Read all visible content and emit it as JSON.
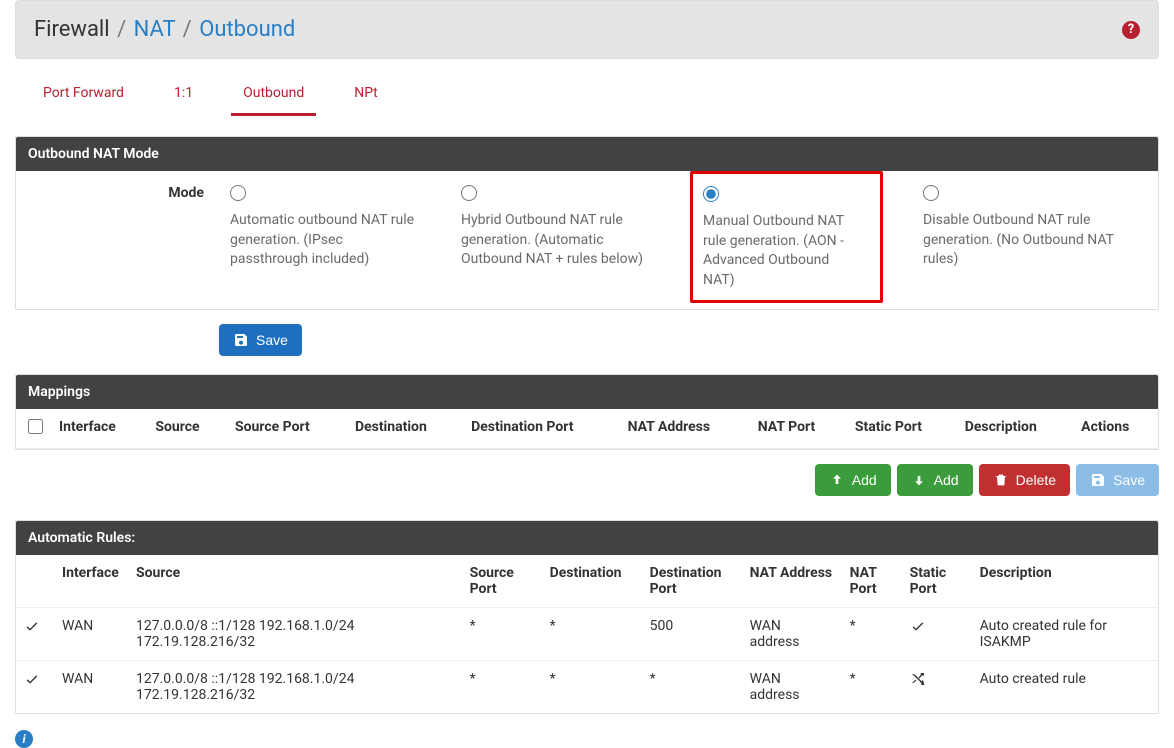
{
  "breadcrumb": {
    "root": "Firewall",
    "mid": "NAT",
    "leaf": "Outbound"
  },
  "tabs": [
    {
      "label": "Port Forward",
      "active": false
    },
    {
      "label": "1:1",
      "active": false
    },
    {
      "label": "Outbound",
      "active": true
    },
    {
      "label": "NPt",
      "active": false
    }
  ],
  "mode_panel": {
    "title": "Outbound NAT Mode",
    "label": "Mode",
    "options": [
      {
        "id": "auto",
        "desc": "Automatic outbound NAT rule generation.\n(IPsec passthrough included)",
        "checked": false,
        "highlight": false
      },
      {
        "id": "hybrid",
        "desc": "Hybrid Outbound NAT rule generation.\n(Automatic Outbound NAT + rules below)",
        "checked": false,
        "highlight": false
      },
      {
        "id": "manual",
        "desc": "Manual Outbound NAT rule generation.\n(AON - Advanced Outbound NAT)",
        "checked": true,
        "highlight": true
      },
      {
        "id": "disable",
        "desc": "Disable Outbound NAT rule generation.\n(No Outbound NAT rules)",
        "checked": false,
        "highlight": false
      }
    ]
  },
  "save_button": "Save",
  "mappings_panel": {
    "title": "Mappings",
    "columns": [
      "Interface",
      "Source",
      "Source Port",
      "Destination",
      "Destination Port",
      "NAT Address",
      "NAT Port",
      "Static Port",
      "Description",
      "Actions"
    ],
    "rows": []
  },
  "action_buttons": {
    "add_top": "Add",
    "add_bottom": "Add",
    "delete": "Delete",
    "save": "Save"
  },
  "auto_panel": {
    "title": "Automatic Rules:",
    "columns": [
      "Interface",
      "Source",
      "Source Port",
      "Destination",
      "Destination Port",
      "NAT Address",
      "NAT Port",
      "Static Port",
      "Description"
    ],
    "rows": [
      {
        "interface": "WAN",
        "source": "127.0.0.0/8 ::1/128 192.168.1.0/24 172.19.128.216/32",
        "source_port": "*",
        "destination": "*",
        "destination_port": "500",
        "nat_address": "WAN address",
        "nat_port": "*",
        "static_port": "check",
        "description": "Auto created rule for ISAKMP"
      },
      {
        "interface": "WAN",
        "source": "127.0.0.0/8 ::1/128 192.168.1.0/24 172.19.128.216/32",
        "source_port": "*",
        "destination": "*",
        "destination_port": "*",
        "nat_address": "WAN address",
        "nat_port": "*",
        "static_port": "random",
        "description": "Auto created rule"
      }
    ]
  }
}
